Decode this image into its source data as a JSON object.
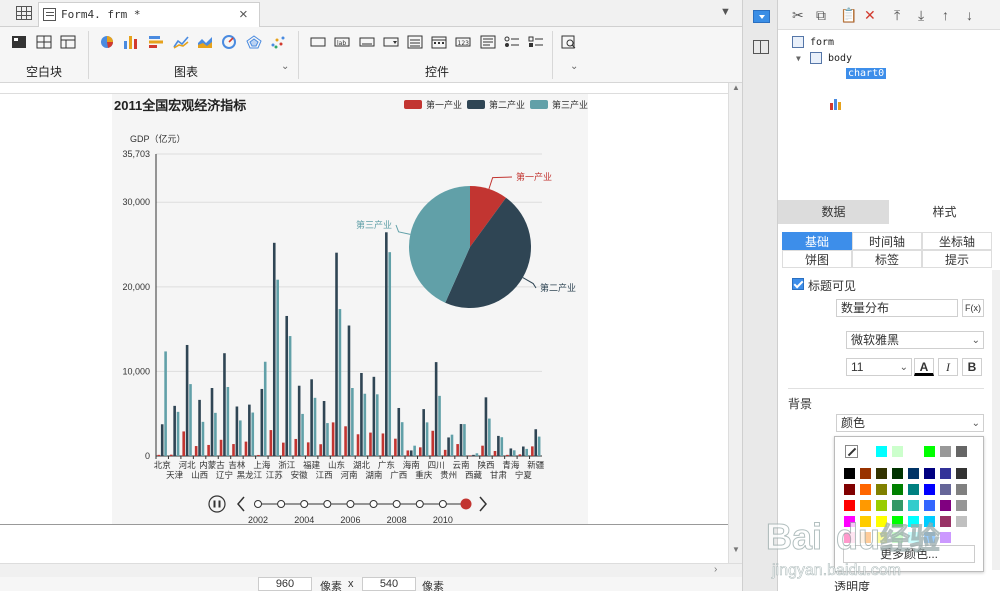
{
  "toolbar": {
    "doc_tab": "Form4. frm *",
    "groups": [
      {
        "label": "空白块"
      },
      {
        "label": "图表"
      },
      {
        "label": "控件"
      }
    ]
  },
  "canvas": {
    "width_value": "960",
    "height_value": "540",
    "unit_label": "像素",
    "times": "x"
  },
  "chart_data": {
    "type": "bar",
    "title": "2011全国宏观经济指标",
    "ylabel": "GDP（亿元）",
    "ylim": [
      0,
      35703
    ],
    "y_ticks": [
      "35,703",
      "30,000",
      "20,000",
      "10,000",
      "0"
    ],
    "y_tick_values": [
      35703,
      30000,
      20000,
      10000,
      0
    ],
    "categories": [
      "北京",
      "天津",
      "河北",
      "山西",
      "内蒙古",
      "辽宁",
      "吉林",
      "黑龙江",
      "上海",
      "江苏",
      "浙江",
      "安徽",
      "福建",
      "江西",
      "山东",
      "河南",
      "湖北",
      "湖南",
      "广东",
      "广西",
      "海南",
      "重庆",
      "四川",
      "贵州",
      "云南",
      "西藏",
      "陕西",
      "甘肃",
      "青海",
      "宁夏",
      "新疆"
    ],
    "category_labels_top": [
      "北京",
      "河北",
      "内蒙古",
      "吉林",
      "上海",
      "浙江",
      "福建",
      "山东",
      "湖北",
      "广东",
      "海南",
      "四川",
      "云南",
      "陕西",
      "青海",
      "新疆"
    ],
    "category_labels_bottom": [
      "天津",
      "山西",
      "辽宁",
      "黑龙江",
      "江苏",
      "安徽",
      "江西",
      "河南",
      "湖南",
      "广西",
      "重庆",
      "贵州",
      "西藏",
      "甘肃",
      "宁夏"
    ],
    "series": [
      {
        "name": "第一产业",
        "color": "#c23531",
        "values": [
          136,
          159,
          2905,
          1177,
          1306,
          1915,
          1412,
          1701,
          124,
          3065,
          1581,
          2015,
          1612,
          1392,
          3974,
          3512,
          2569,
          2768,
          2665,
          2047,
          659,
          1025,
          2983,
          726,
          1411,
          74,
          1221,
          593,
          136,
          192,
          1139
        ]
      },
      {
        "name": "第二产业",
        "color": "#2f4554",
        "values": [
          3752,
          5928,
          13126,
          6635,
          8037,
          12152,
          5852,
          6074,
          7927,
          25204,
          16555,
          8309,
          9069,
          6501,
          24037,
          15427,
          9815,
          9361,
          26448,
          5676,
          659,
          5543,
          11100,
          2194,
          3780,
          136,
          6936,
          2377,
          893,
          1122,
          3164
        ]
      },
      {
        "name": "第三产业",
        "color": "#61a0a8",
        "values": [
          12363,
          5219,
          8500,
          4038,
          5102,
          8159,
          4205,
          5138,
          11142,
          20842,
          14180,
          4975,
          6878,
          3893,
          17371,
          8038,
          7361,
          7293,
          24097,
          3999,
          1221,
          3977,
          7110,
          2523,
          3773,
          321,
          4425,
          2222,
          674,
          838,
          2294
        ]
      }
    ],
    "legend_position": "top-right",
    "pie": {
      "slices": [
        {
          "name": "第一产业",
          "value": 47486,
          "color": "#c23531"
        },
        {
          "name": "第二产业",
          "value": 220413,
          "color": "#2f4554"
        },
        {
          "name": "第三产业",
          "value": 204982,
          "color": "#61a0a8"
        }
      ]
    },
    "timeline": {
      "labels": [
        "2002",
        "2004",
        "2006",
        "2008",
        "2010"
      ],
      "points": 10,
      "current": 9
    }
  },
  "tree": {
    "root": "form",
    "body": "body",
    "chart": "chart0"
  },
  "panel": {
    "tab_data": "数据",
    "tab_style": "样式",
    "sub_tabs": [
      "基础",
      "时间轴",
      "坐标轴",
      "饼图",
      "标签",
      "提示"
    ],
    "title_visible_label": "标题可见",
    "title_value": "数量分布",
    "formula_btn": "F(x)",
    "font_family": "微软雅黑",
    "font_size": "11",
    "bold": "B",
    "italic": "I",
    "color_btn": "A",
    "background_label": "背景",
    "background_type": "颜色",
    "more_colors": "更多颜色...",
    "opacity_label": "透明度",
    "watermark": [
      "Baidu 经验",
      "jingyan.baidu.com"
    ]
  }
}
